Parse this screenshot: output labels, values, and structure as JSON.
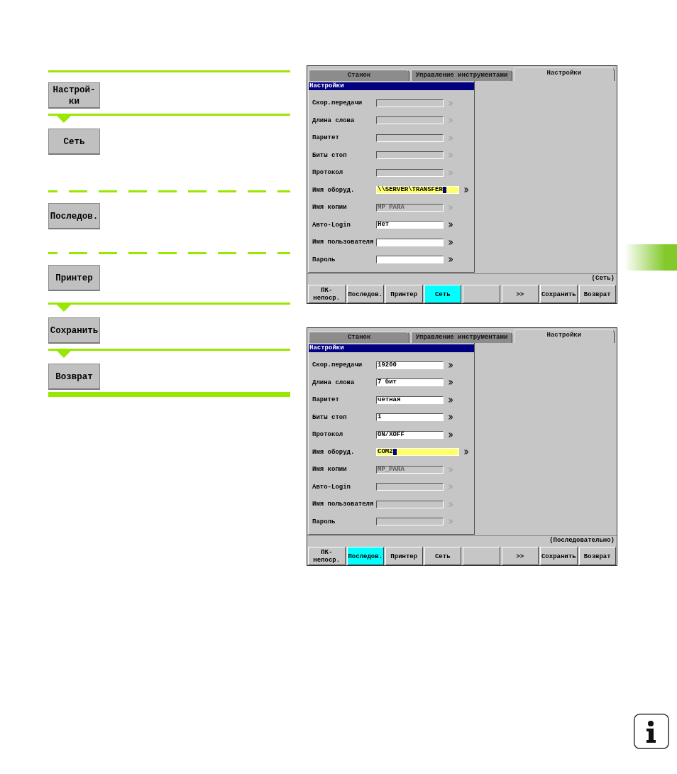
{
  "guide": {
    "items": [
      {
        "kind": "rule"
      },
      {
        "kind": "button",
        "label": "Настрой-\nки"
      },
      {
        "kind": "arrow-rule"
      },
      {
        "kind": "button",
        "label": "Сеть"
      },
      {
        "kind": "dashed-rule"
      },
      {
        "kind": "button",
        "label": "Последов."
      },
      {
        "kind": "dashed-rule"
      },
      {
        "kind": "button",
        "label": "Принтер"
      },
      {
        "kind": "arrow-rule"
      },
      {
        "kind": "button",
        "label": "Сохранить"
      },
      {
        "kind": "arrow-rule"
      },
      {
        "kind": "button",
        "label": "Возврат"
      },
      {
        "kind": "end-bar"
      }
    ]
  },
  "screens": [
    {
      "tabs": [
        {
          "label": "Станок",
          "selected": false
        },
        {
          "label": "Управление инструментами",
          "selected": false
        },
        {
          "label": "Настройки",
          "selected": true
        }
      ],
      "panel_title": "Настройки",
      "fields": [
        {
          "label": "Скор.передачи",
          "disabled": true,
          "focused": false
        },
        {
          "label": "Длина слова",
          "disabled": true,
          "focused": false
        },
        {
          "label": "Паритет",
          "disabled": true,
          "focused": false
        },
        {
          "label": "Биты стоп",
          "disabled": true,
          "focused": false
        },
        {
          "label": "Протокол",
          "disabled": true,
          "focused": false
        },
        {
          "label": "Имя оборуд.",
          "value": "\\\\SERVER\\TRANSFER",
          "disabled": false,
          "focused": true
        },
        {
          "label": "Имя копии",
          "value": "MP PARA",
          "disabled": true,
          "focused": false
        },
        {
          "label": "Авто-Login",
          "value": "Нет",
          "disabled": false,
          "focused": false
        },
        {
          "label": "Имя пользователя",
          "disabled": false,
          "focused": false
        },
        {
          "label": "Пароль",
          "disabled": false,
          "focused": false
        }
      ],
      "status": "(Сеть)",
      "softkeys": [
        {
          "label": "ПК-\nнепоср.",
          "selected": false
        },
        {
          "label": "Последов.",
          "selected": false
        },
        {
          "label": "Принтер",
          "selected": false
        },
        {
          "label": "Сеть",
          "selected": true
        },
        {
          "selected": false
        },
        {
          "label": ">>",
          "selected": false
        },
        {
          "label": "Сохранить",
          "selected": false
        },
        {
          "label": "Возврат",
          "selected": false
        }
      ]
    },
    {
      "tabs": [
        {
          "label": "Станок",
          "selected": false
        },
        {
          "label": "Управление инструментами",
          "selected": false
        },
        {
          "label": "Настройки",
          "selected": true
        }
      ],
      "panel_title": "Настройки",
      "fields": [
        {
          "label": "Скор.передачи",
          "value": "19200",
          "disabled": false,
          "focused": false
        },
        {
          "label": "Длина слова",
          "value": "7 бит",
          "disabled": false,
          "focused": false
        },
        {
          "label": "Паритет",
          "value": "четная",
          "disabled": false,
          "focused": false
        },
        {
          "label": "Биты стоп",
          "value": "1",
          "disabled": false,
          "focused": false
        },
        {
          "label": "Протокол",
          "value": "ON/XOFF",
          "disabled": false,
          "focused": false
        },
        {
          "label": "Имя оборуд.",
          "value": "COM2",
          "disabled": false,
          "focused": true
        },
        {
          "label": "Имя копии",
          "value": "MP_PARA",
          "disabled": true,
          "focused": false
        },
        {
          "label": "Авто-Login",
          "disabled": true,
          "focused": false
        },
        {
          "label": "Имя пользователя",
          "disabled": true,
          "focused": false
        },
        {
          "label": "Пароль",
          "disabled": true,
          "focused": false
        }
      ],
      "status": "(Последовательно)",
      "softkeys": [
        {
          "label": "ПК-\nнепоср.",
          "selected": false
        },
        {
          "label": "Последов.",
          "selected": true
        },
        {
          "label": "Принтер",
          "selected": false
        },
        {
          "label": "Сеть",
          "selected": false
        },
        {
          "selected": false
        },
        {
          "label": ">>",
          "selected": false
        },
        {
          "label": "Сохранить",
          "selected": false
        },
        {
          "label": "Возврат",
          "selected": false
        }
      ]
    }
  ]
}
